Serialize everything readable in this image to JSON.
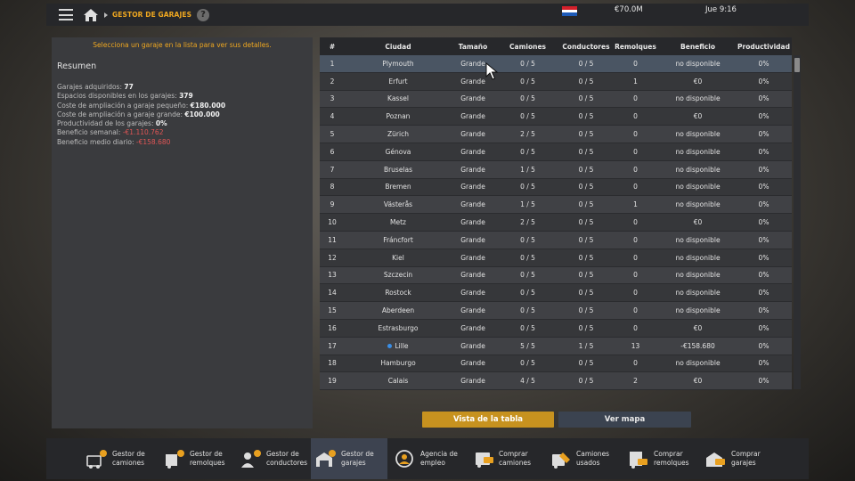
{
  "topbar": {
    "breadcrumb": "GESTOR DE GARAJES",
    "help_glyph": "?",
    "money": "€70.0M",
    "clock": "Jue 9:16",
    "flag_colors": [
      "#d4202a",
      "#ffffff",
      "#1e5bb8"
    ]
  },
  "left": {
    "hint": "Selecciona un garaje en la lista para ver sus detalles.",
    "summary_title": "Resumen",
    "stats": [
      {
        "label": "Garajes adquiridos: ",
        "value": "77"
      },
      {
        "label": "Espacios disponibles en los garajes: ",
        "value": "379"
      },
      {
        "label": "Coste de ampliación a garaje pequeño: ",
        "value": "€180.000"
      },
      {
        "label": "Coste de ampliación a garaje grande: ",
        "value": "€100.000"
      },
      {
        "label": "Productividad de los garajes: ",
        "value": "0%"
      },
      {
        "label": "Beneficio semanal: ",
        "value": "-€1.110.762"
      },
      {
        "label": "Beneficio medio diario: ",
        "value": "-€158.680"
      }
    ]
  },
  "table": {
    "headers": [
      "#",
      "Ciudad",
      "Tamaño",
      "Camiones",
      "Conductores",
      "Remolques",
      "Beneficio",
      "Productividad"
    ],
    "rows": [
      [
        "1",
        "Plymouth",
        "Grande",
        "0 / 5",
        "0 / 5",
        "0",
        "no disponible",
        "0%"
      ],
      [
        "2",
        "Erfurt",
        "Grande",
        "0 / 5",
        "0 / 5",
        "1",
        "€0",
        "0%"
      ],
      [
        "3",
        "Kassel",
        "Grande",
        "0 / 5",
        "0 / 5",
        "0",
        "no disponible",
        "0%"
      ],
      [
        "4",
        "Poznan",
        "Grande",
        "0 / 5",
        "0 / 5",
        "0",
        "€0",
        "0%"
      ],
      [
        "5",
        "Zürich",
        "Grande",
        "2 / 5",
        "0 / 5",
        "0",
        "no disponible",
        "0%"
      ],
      [
        "6",
        "Génova",
        "Grande",
        "0 / 5",
        "0 / 5",
        "0",
        "no disponible",
        "0%"
      ],
      [
        "7",
        "Bruselas",
        "Grande",
        "1 / 5",
        "0 / 5",
        "0",
        "no disponible",
        "0%"
      ],
      [
        "8",
        "Bremen",
        "Grande",
        "0 / 5",
        "0 / 5",
        "0",
        "no disponible",
        "0%"
      ],
      [
        "9",
        "Västerås",
        "Grande",
        "1 / 5",
        "0 / 5",
        "1",
        "no disponible",
        "0%"
      ],
      [
        "10",
        "Metz",
        "Grande",
        "2 / 5",
        "0 / 5",
        "0",
        "€0",
        "0%"
      ],
      [
        "11",
        "Fráncfort",
        "Grande",
        "0 / 5",
        "0 / 5",
        "0",
        "no disponible",
        "0%"
      ],
      [
        "12",
        "Kiel",
        "Grande",
        "0 / 5",
        "0 / 5",
        "0",
        "no disponible",
        "0%"
      ],
      [
        "13",
        "Szczecin",
        "Grande",
        "0 / 5",
        "0 / 5",
        "0",
        "no disponible",
        "0%"
      ],
      [
        "14",
        "Rostock",
        "Grande",
        "0 / 5",
        "0 / 5",
        "0",
        "no disponible",
        "0%"
      ],
      [
        "15",
        "Aberdeen",
        "Grande",
        "0 / 5",
        "0 / 5",
        "0",
        "no disponible",
        "0%"
      ],
      [
        "16",
        "Estrasburgo",
        "Grande",
        "0 / 5",
        "0 / 5",
        "0",
        "€0",
        "0%"
      ],
      [
        "17",
        "Lille",
        "Grande",
        "5 / 5",
        "1 / 5",
        "13",
        "-€158.680",
        "0%"
      ],
      [
        "18",
        "Hamburgo",
        "Grande",
        "0 / 5",
        "0 / 5",
        "0",
        "no disponible",
        "0%"
      ],
      [
        "19",
        "Calais",
        "Grande",
        "4 / 5",
        "0 / 5",
        "2",
        "€0",
        "0%"
      ]
    ],
    "selected_row": 1,
    "hq_row": 17,
    "hq_marker_color": "#3a8ee6"
  },
  "buttons": {
    "table_view": "Vista de la tabla",
    "map_view": "Ver mapa"
  },
  "bottom_nav": [
    {
      "label": "Gestor de\ncamiones",
      "icon": "truck-gear-icon"
    },
    {
      "label": "Gestor de\nremolques",
      "icon": "trailer-gear-icon"
    },
    {
      "label": "Gestor de\nconductores",
      "icon": "driver-gear-icon"
    },
    {
      "label": "Gestor de\ngarajes",
      "icon": "garage-gear-icon",
      "active": true
    },
    {
      "label": "Agencia de\nempleo",
      "icon": "recruitment-agency-icon"
    },
    {
      "label": "Comprar\ncamiones",
      "icon": "buy-truck-icon"
    },
    {
      "label": "Camiones\nusados",
      "icon": "used-trucks-icon"
    },
    {
      "label": "Comprar\nremolques",
      "icon": "buy-trailer-icon"
    },
    {
      "label": "Comprar\ngarajes",
      "icon": "buy-garage-icon"
    }
  ]
}
